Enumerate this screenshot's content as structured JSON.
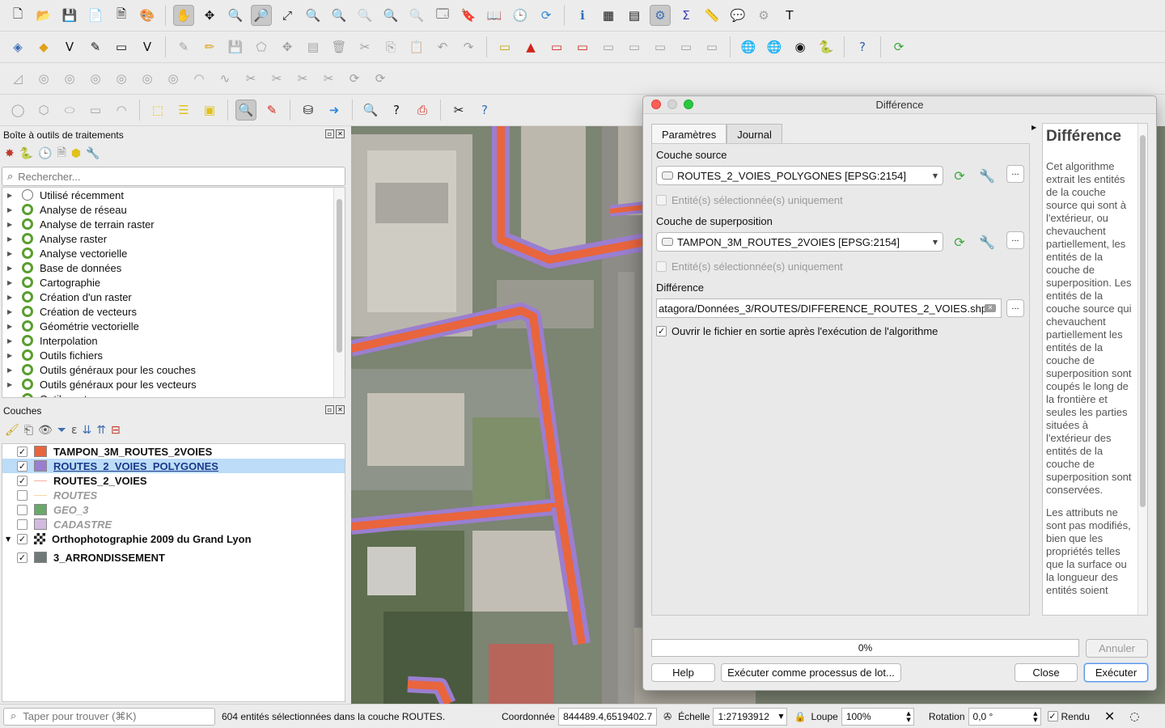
{
  "colors": {
    "tampon": "#e8653d",
    "routes_polygones": "#9b7ed0",
    "routes_line": "#f0b0a3",
    "routes_off": "#f7d7a5",
    "geo3": "#6aa86a",
    "cadastre": "#d2bbdf",
    "arrondissement": "#6f7a78",
    "selection": "#bcdcf8"
  },
  "toolbox": {
    "title": "Boîte à outils de traitements",
    "search_placeholder": "Rechercher...",
    "items": [
      {
        "label": "Utilisé récemment",
        "icon": "clock-icon"
      },
      {
        "label": "Analyse de réseau",
        "icon": "qgis-icon"
      },
      {
        "label": "Analyse de terrain raster",
        "icon": "qgis-icon"
      },
      {
        "label": "Analyse raster",
        "icon": "qgis-icon"
      },
      {
        "label": "Analyse vectorielle",
        "icon": "qgis-icon"
      },
      {
        "label": "Base de données",
        "icon": "qgis-icon"
      },
      {
        "label": "Cartographie",
        "icon": "qgis-icon"
      },
      {
        "label": "Création d'un raster",
        "icon": "qgis-icon"
      },
      {
        "label": "Création de vecteurs",
        "icon": "qgis-icon"
      },
      {
        "label": "Géométrie vectorielle",
        "icon": "qgis-icon"
      },
      {
        "label": "Interpolation",
        "icon": "qgis-icon"
      },
      {
        "label": "Outils fichiers",
        "icon": "qgis-icon"
      },
      {
        "label": "Outils généraux pour les couches",
        "icon": "qgis-icon"
      },
      {
        "label": "Outils généraux pour les vecteurs",
        "icon": "qgis-icon"
      },
      {
        "label": "Outils rasters",
        "icon": "qgis-icon"
      }
    ]
  },
  "layers": {
    "title": "Couches",
    "items": [
      {
        "name": "TAMPON_3M_ROUTES_2VOIES",
        "checked": true
      },
      {
        "name": "ROUTES_2_VOIES_POLYGONES",
        "checked": true
      },
      {
        "name": "ROUTES_2_VOIES",
        "checked": true
      },
      {
        "name": "ROUTES",
        "checked": false
      },
      {
        "name": "GEO_3",
        "checked": false
      },
      {
        "name": "CADASTRE",
        "checked": false
      },
      {
        "name": "Orthophotographie 2009 du Grand Lyon",
        "checked": true
      },
      {
        "name": "3_ARRONDISSEMENT",
        "checked": true
      }
    ]
  },
  "dialog": {
    "title": "Différence",
    "tabs": [
      "Paramètres",
      "Journal"
    ],
    "source_label": "Couche source",
    "source_value": "ROUTES_2_VOIES_POLYGONES [EPSG:2154]",
    "selected_only_label": "Entité(s) sélectionnée(s) uniquement",
    "overlay_label": "Couche de superposition",
    "overlay_value": "TAMPON_3M_ROUTES_2VOIES [EPSG:2154]",
    "output_label": "Différence",
    "output_value": "atagora/Données_3/ROUTES/DIFFERENCE_ROUTES_2_VOIES.shp",
    "open_output_label": "Ouvrir le fichier en sortie après l'exécution de l'algorithme",
    "dots": "...",
    "help_title": "Différence",
    "help_p1": "Cet algorithme extrait les entités de la couche source qui sont à l'extérieur, ou chevauchent partiellement, les entités de la couche de superposition. Les entités de la couche source qui chevauchent partiellement les entités de la couche de superposition sont coupés le long de la frontière et seules les parties situées à l'extérieur des entités de la couche de superposition sont conservées.",
    "help_p2": "Les attributs ne sont pas modifiés, bien que les propriétés telles que la surface ou la longueur des entités soient",
    "progress": "0%",
    "btn_cancel": "Annuler",
    "btn_help": "Help",
    "btn_batch": "Exécuter comme processus de lot...",
    "btn_close": "Close",
    "btn_run": "Exécuter"
  },
  "statusbar": {
    "locator_placeholder": "Taper pour trouver (⌘K)",
    "message": "604 entités sélectionnées dans la couche ROUTES.",
    "coord_label": "Coordonnée",
    "coord_value": "844489.4,6519402.7",
    "scale_label": "Échelle",
    "scale_value": "1:27193912",
    "zoom_label": "Loupe",
    "zoom_value": "100%",
    "rotation_label": "Rotation",
    "rotation_value": "0,0 °",
    "render_label": "Rendu"
  }
}
